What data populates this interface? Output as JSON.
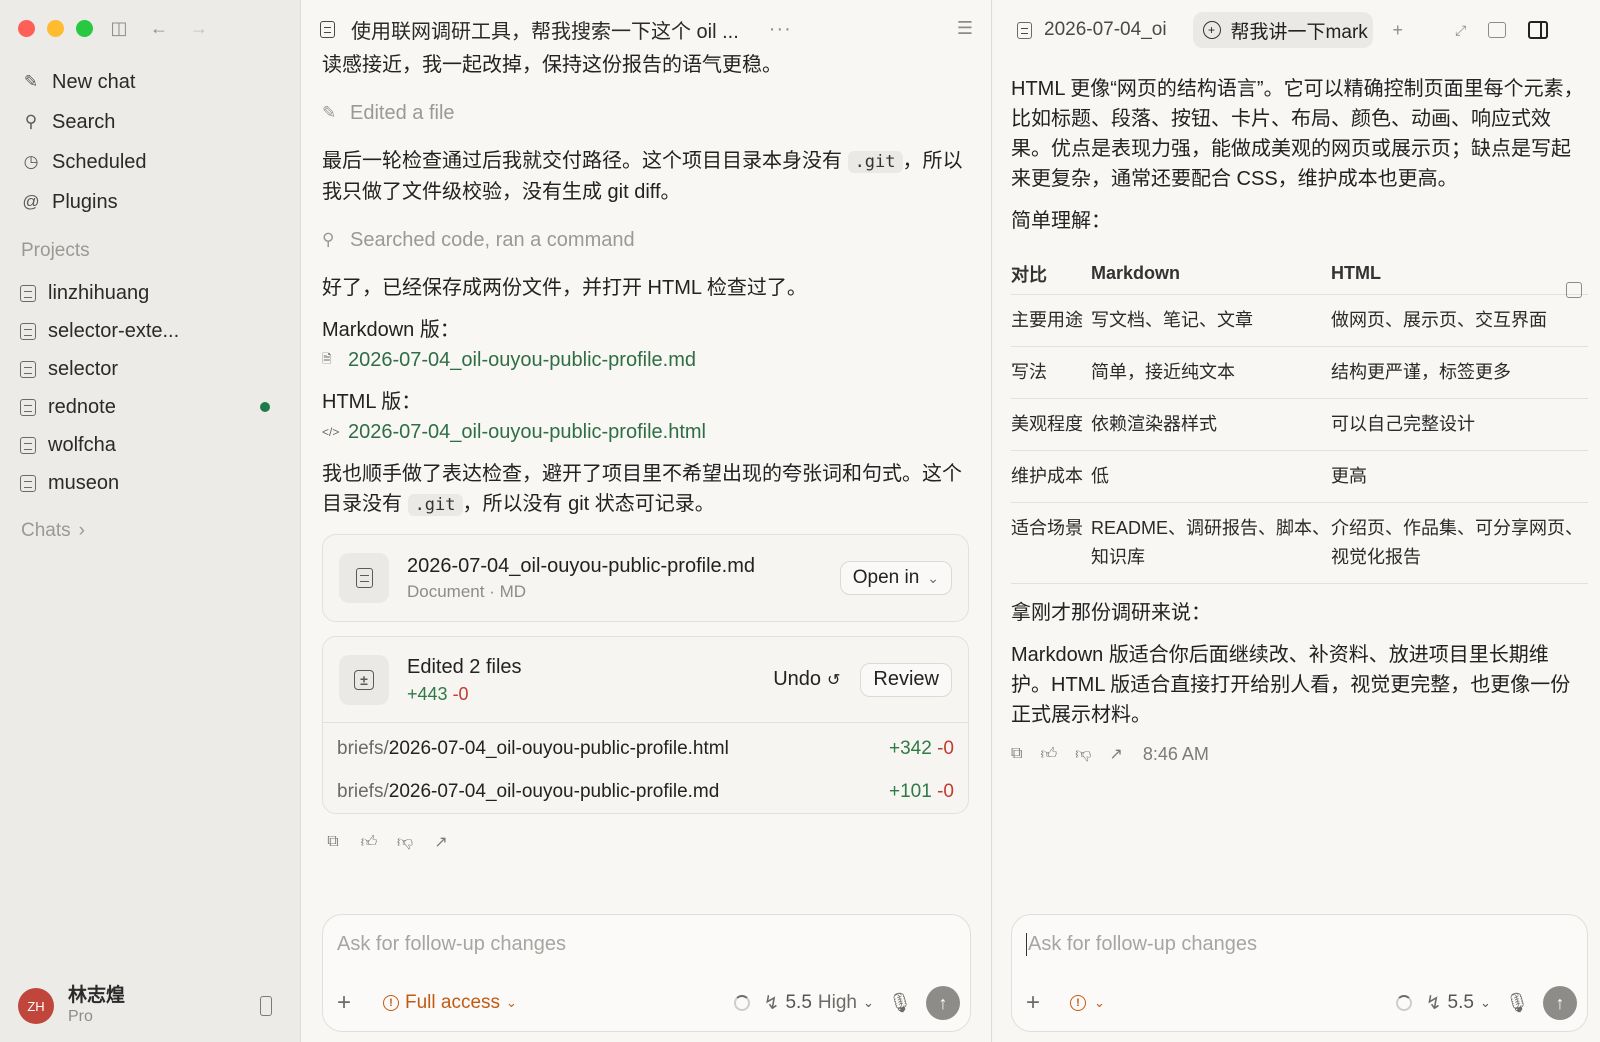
{
  "sidebar": {
    "nav": [
      {
        "label": "New chat",
        "icon": "compose-icon"
      },
      {
        "label": "Search",
        "icon": "search-icon"
      },
      {
        "label": "Scheduled",
        "icon": "clock-icon"
      },
      {
        "label": "Plugins",
        "icon": "at-icon"
      }
    ],
    "projects_label": "Projects",
    "projects": [
      {
        "label": "linzhihuang"
      },
      {
        "label": "selector-exte..."
      },
      {
        "label": "selector"
      },
      {
        "label": "rednote",
        "unread": true
      },
      {
        "label": "wolfcha"
      },
      {
        "label": "museon"
      }
    ],
    "chats_label": "Chats",
    "user": {
      "initials": "ZH",
      "name": "林志煌",
      "plan": "Pro"
    }
  },
  "middle": {
    "title": "使用联网调研工具，帮我搜索一下这个 oil ...",
    "menu": "···",
    "p_top": "读感接近，我一起改掉，保持这份报告的语气更稳。",
    "activity_edit": "Edited a file",
    "p_check_1": "最后一轮检查通过后我就交付路径。这个项目目录本身没有",
    "git_code": ".git",
    "p_check_2": "，所以",
    "p_check_3": "我只做了文件级校验，没有生成 git diff。",
    "activity_search": "Searched code, ran a command",
    "p_saved": "好了，已经保存成两份文件，并打开 HTML 检查过了。",
    "md_label": "Markdown 版：",
    "md_link": "2026-07-04_oil-ouyou-public-profile.md",
    "html_label": "HTML 版：",
    "html_link": "2026-07-04_oil-ouyou-public-profile.html",
    "p_expr_1": "我也顺手做了表达检查，避开了项目里不希望出现的夸张词和句式。这个",
    "p_expr_2": "目录没有",
    "p_expr_3": "，所以没有 git 状态可记录。",
    "file_card": {
      "name": "2026-07-04_oil-ouyou-public-profile.md",
      "meta": "Document · MD",
      "open_label": "Open in"
    },
    "edit_card": {
      "title": "Edited 2 files",
      "added": "+443",
      "removed": "-0",
      "undo_label": "Undo",
      "review_label": "Review",
      "files": [
        {
          "dir": "briefs/",
          "name": "2026-07-04_oil-ouyou-public-profile.html",
          "added": "+342",
          "removed": "-0"
        },
        {
          "dir": "briefs/",
          "name": "2026-07-04_oil-ouyou-public-profile.md",
          "added": "+101",
          "removed": "-0"
        }
      ]
    },
    "composer": {
      "placeholder": "Ask for follow-up changes",
      "access_label": "Full access",
      "model": "5.5",
      "level": "High"
    }
  },
  "right": {
    "tab1_label": "2026-07-04_oi",
    "tab2_label": "帮我讲一下mark",
    "p_intro": "HTML 更像“网页的结构语言”。它可以精确控制页面里每个元素，比如标题、段落、按钮、卡片、布局、颜色、动画、响应式效果。优点是表现力强，能做成美观的网页或展示页；缺点是写起来更复杂，通常还要配合 CSS，维护成本也更高。",
    "p_simple": "简单理解：",
    "table": {
      "headers": [
        "对比",
        "Markdown",
        "HTML"
      ],
      "rows": [
        [
          "主要用途",
          "写文档、笔记、文章",
          "做网页、展示页、交互界面"
        ],
        [
          "写法",
          "简单，接近纯文本",
          "结构更严谨，标签更多"
        ],
        [
          "美观程度",
          "依赖渲染器样式",
          "可以自己完整设计"
        ],
        [
          "维护成本",
          "低",
          "更高"
        ],
        [
          "适合场景",
          "README、调研报告、脚本、知识库",
          "介绍页、作品集、可分享网页、视觉化报告"
        ]
      ]
    },
    "p_case": "拿刚才那份调研来说：",
    "p_conclusion": "Markdown 版适合你后面继续改、补资料、放进项目里长期维护。HTML 版适合直接打开给别人看，视觉更完整，也更像一份正式展示材料。",
    "time": "8:46 AM",
    "composer": {
      "placeholder": "Ask for follow-up changes",
      "model": "5.5"
    }
  },
  "colors": {
    "accent_green": "#2f6e45",
    "warning_orange": "#c25b12",
    "add_green": "#2f7a45",
    "remove_red": "#c23b2e"
  }
}
